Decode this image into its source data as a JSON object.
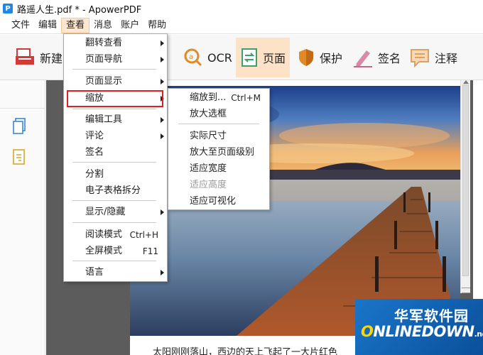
{
  "window": {
    "title": "路遥人生.pdf * - ApowerPDF",
    "logo_letter": "P"
  },
  "menubar": {
    "items": [
      {
        "label": "文件"
      },
      {
        "label": "编辑"
      },
      {
        "label": "查看"
      },
      {
        "label": "消息"
      },
      {
        "label": "账户"
      },
      {
        "label": "帮助"
      }
    ]
  },
  "toolbar": {
    "new": "新建",
    "ocr": "OCR",
    "page": "页面",
    "protect": "保护",
    "sign": "签名",
    "comment": "注释"
  },
  "view_menu": {
    "items": [
      {
        "label": "翻转查看",
        "submenu": true
      },
      {
        "label": "页面导航",
        "submenu": true
      },
      {
        "label": "页面显示",
        "submenu": true
      },
      {
        "label": "缩放",
        "submenu": true
      },
      {
        "label": "编辑工具",
        "submenu": true
      },
      {
        "label": "评论",
        "submenu": true
      },
      {
        "label": "签名"
      },
      {
        "label": "分割"
      },
      {
        "label": "电子表格拆分"
      },
      {
        "label": "显示/隐藏",
        "submenu": true
      },
      {
        "label": "阅读模式",
        "shortcut": "Ctrl+H"
      },
      {
        "label": "全屏模式",
        "shortcut": "F11"
      },
      {
        "label": "语言",
        "submenu": true
      }
    ]
  },
  "zoom_submenu": {
    "items": [
      {
        "label": "缩放到...",
        "shortcut": "Ctrl+M"
      },
      {
        "label": "放大选框"
      },
      {
        "label": "实际尺寸"
      },
      {
        "label": "放大至页面级别"
      },
      {
        "label": "适应宽度"
      },
      {
        "label": "适应高度",
        "disabled": true
      },
      {
        "label": "适应可视化"
      }
    ]
  },
  "document": {
    "visible_text": "太阳刚刚落山，西边的天上飞起了一大片红色"
  },
  "watermark": {
    "cn": "华军软件园",
    "en_prefix": "NLINEDOWN",
    "en_o": "O",
    "en_suffix": ".net"
  },
  "colors": {
    "highlight": "#e02020",
    "active_tool": "#fde2c8",
    "menu_active": "#ffe7cf"
  }
}
